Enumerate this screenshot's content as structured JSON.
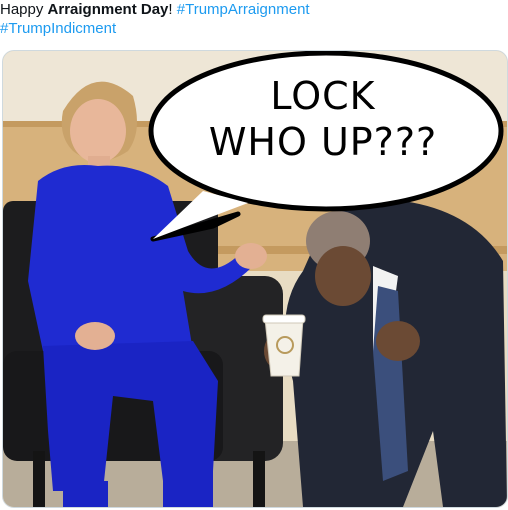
{
  "tweet": {
    "prefix": "Happy ",
    "bold": "Arraignment Day",
    "suffix": "! ",
    "hashtag1": "#TrumpArraignment",
    "hashtag2": "#TrumpIndicment"
  },
  "meme": {
    "bubble_line1": "LOCK",
    "bubble_line2": "WHO UP???"
  },
  "colors": {
    "link": "#1d9bf0",
    "text": "#0f1419",
    "suit_blue": "#1f2bd1",
    "wall": "#e6d7b8"
  }
}
